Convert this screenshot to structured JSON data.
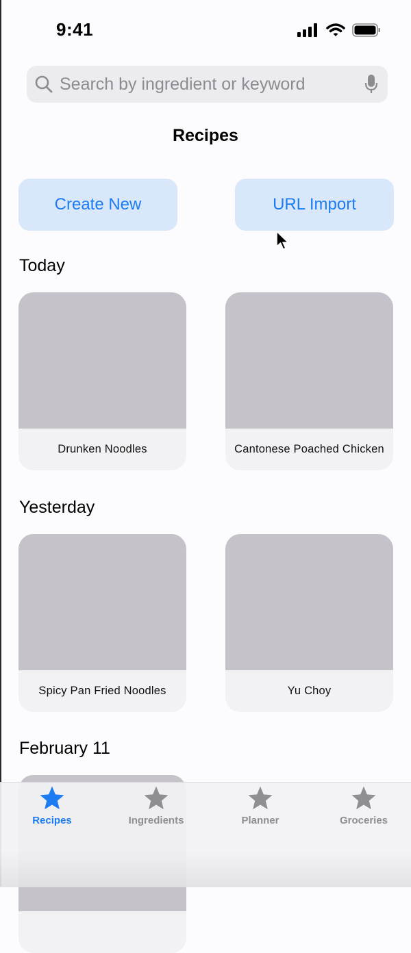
{
  "status_bar": {
    "time": "9:41"
  },
  "search": {
    "placeholder": "Search by ingredient or keyword"
  },
  "page": {
    "title": "Recipes"
  },
  "actions": {
    "create_new": "Create New",
    "url_import": "URL Import"
  },
  "sections": [
    {
      "title": "Today",
      "recipes": [
        "Drunken Noodles",
        "Cantonese Poached Chicken"
      ]
    },
    {
      "title": "Yesterday",
      "recipes": [
        "Spicy Pan Fried Noodles",
        "Yu Choy"
      ]
    },
    {
      "title": "February 11",
      "recipes": [
        ""
      ]
    }
  ],
  "tabbar": {
    "tabs": [
      {
        "label": "Recipes",
        "icon": "star-icon",
        "active": true
      },
      {
        "label": "Ingredients",
        "icon": "star-icon",
        "active": false
      },
      {
        "label": "Planner",
        "icon": "star-icon",
        "active": false
      },
      {
        "label": "Groceries",
        "icon": "star-icon",
        "active": false
      }
    ]
  },
  "colors": {
    "accent": "#1d7cf2",
    "button_bg": "#d9e7fb",
    "thumb_placeholder": "#c5c3c9",
    "card_bg": "#f2f1f4",
    "inactive_tab": "#8e8e93"
  }
}
